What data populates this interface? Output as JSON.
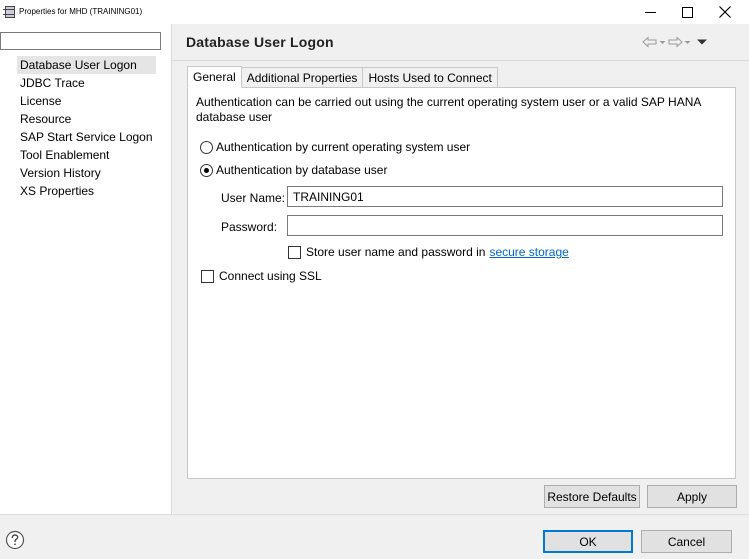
{
  "window": {
    "title": "Properties for MHD (TRAINING01)"
  },
  "filter": {
    "value": "",
    "placeholder": ""
  },
  "nav_tree": {
    "items": [
      {
        "label": "Database User Logon",
        "selected": true
      },
      {
        "label": "JDBC Trace"
      },
      {
        "label": "License"
      },
      {
        "label": "Resource"
      },
      {
        "label": "SAP Start Service Logon"
      },
      {
        "label": "Tool Enablement"
      },
      {
        "label": "Version History"
      },
      {
        "label": "XS Properties"
      }
    ]
  },
  "page": {
    "title": "Database User Logon"
  },
  "tabs": [
    {
      "label": "General",
      "active": true
    },
    {
      "label": "Additional Properties"
    },
    {
      "label": "Hosts Used to Connect"
    }
  ],
  "general": {
    "description": "Authentication can be carried out using the current operating system user or a valid SAP HANA database user",
    "auth_os_label": "Authentication by current operating system user",
    "auth_db_label": "Authentication by database user",
    "selected_auth": "database user",
    "user_name_label": "User Name:",
    "user_name_value": "TRAINING01",
    "password_label": "Password:",
    "password_value": "",
    "store_label": "Store user name and password in",
    "store_link": "secure storage",
    "store_checked": false,
    "ssl_label": "Connect using SSL",
    "ssl_checked": false
  },
  "buttons": {
    "restore_defaults": "Restore Defaults",
    "apply": "Apply",
    "ok": "OK",
    "cancel": "Cancel"
  },
  "colors": {
    "link": "#0066cc",
    "default_button_border": "#0078d7",
    "selection": "#e5e5e5"
  }
}
